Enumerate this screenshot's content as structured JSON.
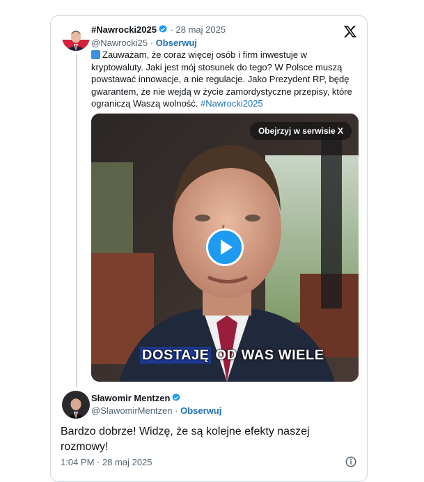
{
  "quoted_tweet": {
    "display_name": "#Nawrocki2025",
    "date": "28 maj 2025",
    "handle": "@Nawrocki25",
    "follow_label": "Obserwuj",
    "text": "Zauważam, że coraz więcej osób i firm inwestuje w kryptowaluty. Jaki jest mój stosunek do tego? W Polsce muszą powstawać innowacje, a nie regulacje. Jako Prezydent RP, będę gwarantem, że nie wejdą w życie zamordystyczne przepisy, które ograniczą Waszą wolność.",
    "hashtag": "#Nawrocki2025",
    "emoji_icon": "blue-square-icon"
  },
  "video": {
    "watch_label": "Obejrzyj w serwisie X",
    "caption_highlight": "DOSTAJĘ",
    "caption_rest": "OD WAS WIELE"
  },
  "author": {
    "display_name": "Sławomir Mentzen",
    "handle": "@SlawomirMentzen",
    "follow_label": "Obserwuj",
    "text": "Bardzo dobrze! Widzę, że są kolejne efekty naszej rozmowy!",
    "time": "1:04 PM",
    "date": "28 maj 2025"
  },
  "colors": {
    "link": "#1d70b8",
    "verified": "#1d9bf0",
    "border": "#cfd9de",
    "muted": "#536471"
  }
}
